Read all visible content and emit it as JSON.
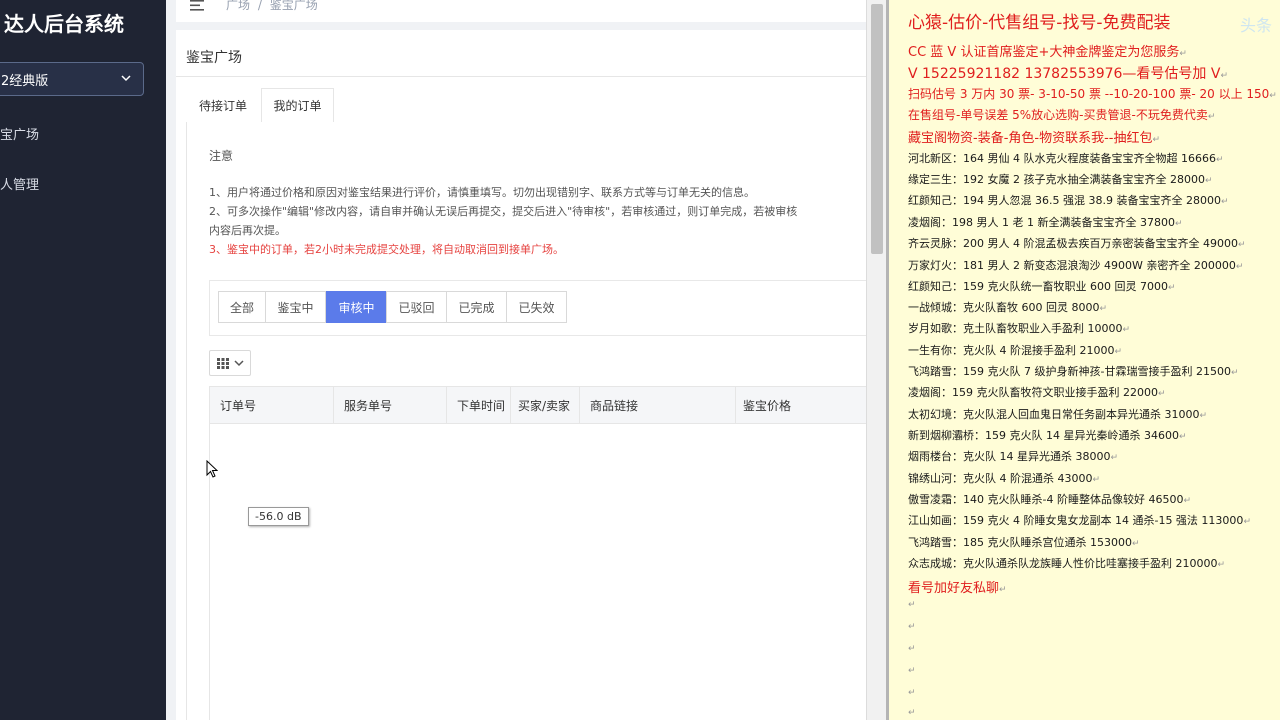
{
  "app": {
    "title": "达人后台系统"
  },
  "sidebar": {
    "version_select": "2经典版",
    "items": [
      {
        "label": "宝广场"
      },
      {
        "label": "人管理"
      }
    ]
  },
  "header": {
    "breadcrumb": [
      "广场",
      "/",
      "鉴宝广场"
    ]
  },
  "main": {
    "page_title": "鉴宝广场",
    "tabs": [
      {
        "label": "待接订单"
      },
      {
        "label": "我的订单"
      }
    ],
    "notice": {
      "title": "注意",
      "lines": [
        "1、用户将通过价格和原因对鉴宝结果进行评价，请慎重填写。切勿出现错别字、联系方式等与订单无关的信息。",
        "2、可多次操作\"编辑\"修改内容，请自审并确认无误后再提交，提交后进入\"待审核\"，若审核通过，则订单完成，若被审核",
        "内容后再次提。",
        "3、鉴宝中的订单，若2小时未完成提交处理，将自动取消回到接单广场。"
      ]
    },
    "filters": [
      {
        "label": "全部"
      },
      {
        "label": "鉴宝中"
      },
      {
        "label": "审核中"
      },
      {
        "label": "已驳回"
      },
      {
        "label": "已完成"
      },
      {
        "label": "已失效"
      }
    ],
    "active_filter": "审核中",
    "table": {
      "columns": [
        "订单号",
        "服务单号",
        "下单时间",
        "买家/卖家",
        "商品链接",
        "鉴宝价格"
      ]
    },
    "tooltip": "-56.0 dB"
  },
  "ad": {
    "headline": "心猿-估价-代售组号-找号-免费配装",
    "watermark": "头条",
    "red_lines": [
      "CC 蓝 V 认证首席鉴定+大神金牌鉴定为您服务",
      "V 15225921182     13782553976—看号估号加 V",
      "扫码估号 3 万内 30 票- 3-10-50 票 --10-20-100 票- 20 以上 150",
      "在售组号-单号误差 5%放心选购-买贵管退-不玩免费代卖",
      "藏宝阁物资-装备-角色-物资联系我--抽红包"
    ],
    "listings": [
      "河北新区：164 男仙 4 队水克火程度装备宝宝齐全物超 16666",
      "缘定三生：192 女魔 2 孩子克水抽全满装备宝宝齐全 28000",
      "红颜知己：194 男人忽混 36.5 强混 38.9 装备宝宝齐全 28000",
      "凌烟阁：198 男人 1 老 1 新全满装备宝宝齐全 37800",
      "齐云灵脉：200 男人 4 阶混孟极去疾百万亲密装备宝宝齐全 49000",
      "万家灯火：181 男人 2 新变态混浪淘沙 4900W 亲密齐全 200000",
      "红颜知己：159 克火队统一畜牧职业 600 回灵 7000",
      "一战倾城：克火队畜牧 600 回灵 8000",
      "岁月如歌：克土队畜牧职业入手盈利 10000",
      "一生有你：克火队 4 阶混接手盈利 21000",
      "飞鸿踏雪：159 克火队 7 级护身新神孩-甘霖瑞雪接手盈利 21500",
      "凌烟阁：159 克火队畜牧符文职业接手盈利 22000",
      "太初幻境：克火队混人回血鬼日常任务副本异光通杀 31000",
      "新到烟柳灞桥：159 克火队 14 星异光秦岭通杀 34600",
      "烟雨楼台：克火队 14 星异光通杀 38000",
      "锦绣山河：克火队 4 阶混通杀 43000",
      "傲雪凌霜：140 克火队睡杀-4 阶睡整体品像较好 46500",
      "江山如画：159 克火 4 阶睡女鬼女龙副本 14 通杀-15 强法 113000",
      "飞鸿踏雪：185 克火队睡杀宫位通杀 153000",
      "众志成城：克火队通杀队龙族睡人性价比哇塞接手盈利 210000"
    ],
    "footer": "看号加好友私聊"
  },
  "colors": {
    "sidebar_bg": "#1f2433",
    "accent": "#5b7bea",
    "warning_red": "#e64340",
    "ad_bg": "#fffdd7",
    "ad_red": "#e01e1e"
  }
}
